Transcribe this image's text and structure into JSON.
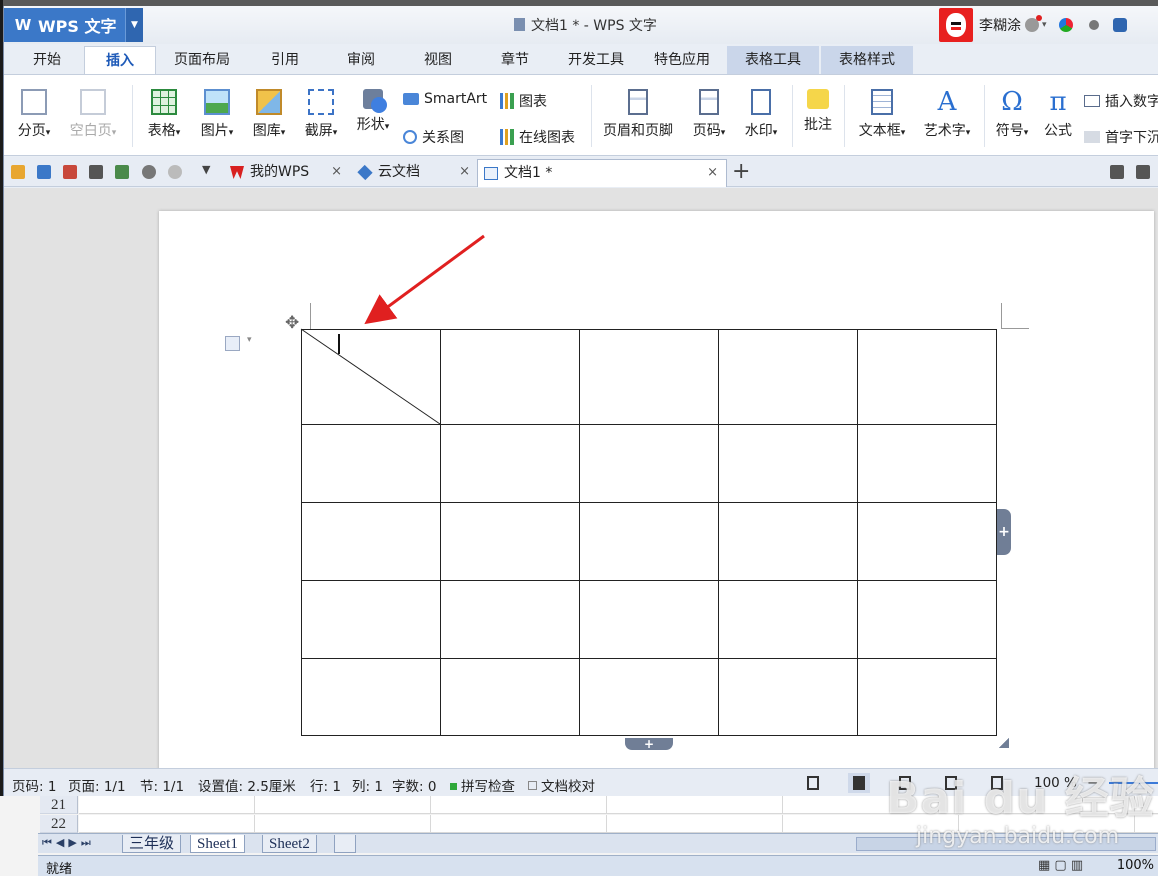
{
  "app": {
    "logo": "W",
    "name": "WPS 文字",
    "window_title": "文档1 * - WPS 文字",
    "user_name": "李糊涂"
  },
  "ribbon_tabs": [
    "开始",
    "插入",
    "页面布局",
    "引用",
    "审阅",
    "视图",
    "章节",
    "开发工具",
    "特色应用",
    "表格工具",
    "表格样式"
  ],
  "ribbon": {
    "page_break": "分页",
    "blank_page": "空白页",
    "table": "表格",
    "picture": "图片",
    "gallery": "图库",
    "screenshot": "截屏",
    "shape": "形状",
    "smartart": "SmartArt",
    "chart": "图表",
    "relation_chart": "关系图",
    "online_chart": "在线图表",
    "header_footer": "页眉和页脚",
    "page_number": "页码",
    "watermark": "水印",
    "comment": "批注",
    "text_box": "文本框",
    "word_art": "艺术字",
    "symbol": "符号",
    "formula": "公式",
    "insert_number": "插入数字",
    "drop_cap": "首字下沉",
    "dropdown_glyph": "▾"
  },
  "doc_tabs": [
    {
      "label": "我的WPS"
    },
    {
      "label": "云文档"
    },
    {
      "label": "文档1 *"
    }
  ],
  "glyphs": {
    "close": "×",
    "new_tab": "+",
    "dropdown": "▼",
    "move": "✥",
    "plus": "+",
    "arrow_down": "▾",
    "omega": "Ω",
    "pi": "π",
    "art_a": "A"
  },
  "status": {
    "page_code": "页码: 1",
    "pages": "页面: 1/1",
    "section": "节: 1/1",
    "setting": "设置值: 2.5厘米",
    "row": "行: 1",
    "col": "列: 1",
    "word_count": "字数: 0",
    "spell_check": "拼写检查",
    "doc_proof": "文档校对",
    "zoom": "100 %",
    "zoom_minus": "−"
  },
  "table": {
    "rows": 5,
    "cols": 5,
    "row_heights": [
      95,
      78,
      78,
      78,
      77
    ]
  },
  "excel": {
    "row_numbers": [
      "21",
      "22"
    ],
    "sheets": [
      "三年级",
      "Sheet1",
      "Sheet2"
    ],
    "status": "就绪",
    "zoom": "100%"
  },
  "watermark": {
    "logo": "Bai du 经验",
    "url": "jingyan.baidu.com"
  },
  "colors": {
    "accent": "#3b78c8",
    "annotation_arrow": "#e02020"
  }
}
